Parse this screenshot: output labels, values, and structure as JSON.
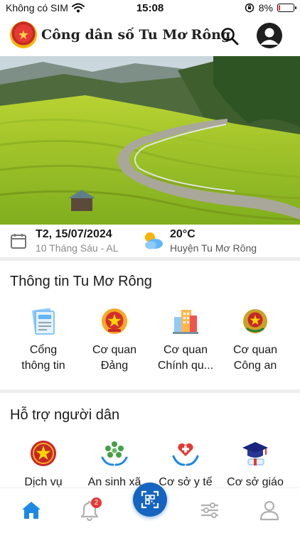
{
  "status_bar": {
    "carrier": "Không có SIM",
    "time": "15:08",
    "battery_percent": "8%",
    "battery_level": 0.08
  },
  "header": {
    "title": "Công dân số Tu Mơ Rông",
    "logo_icon": "national-emblem-icon",
    "search_icon": "search-icon",
    "account_icon": "account-icon"
  },
  "info": {
    "date": "T2, 15/07/2024",
    "lunar_date": "10 Tháng Sáu - AL",
    "temperature": "20°C",
    "location": "Huyện Tu Mơ Rông"
  },
  "section_info": {
    "title": "Thông tin Tu Mơ Rông",
    "items": [
      {
        "label": "Cổng\nthông tin",
        "icon": "newspaper-icon"
      },
      {
        "label": "Cơ quan\nĐảng",
        "icon": "party-emblem-icon"
      },
      {
        "label": "Cơ quan\nChính qu...",
        "icon": "government-building-icon"
      },
      {
        "label": "Cơ quan\nCông an",
        "icon": "police-emblem-icon"
      }
    ]
  },
  "section_support": {
    "title": "Hỗ trợ người dân",
    "items": [
      {
        "label": "Dịch vụ",
        "icon": "public-service-icon"
      },
      {
        "label": "An sinh xã",
        "icon": "social-welfare-icon"
      },
      {
        "label": "Cơ sở y tế",
        "icon": "healthcare-icon"
      },
      {
        "label": "Cơ sở giáo",
        "icon": "education-icon"
      }
    ]
  },
  "bottom_nav": {
    "notification_count": "2",
    "items": [
      "home-icon",
      "bell-icon",
      "qr-scan-icon",
      "sliders-icon",
      "profile-icon"
    ]
  },
  "colors": {
    "accent": "#1565c0",
    "home_active": "#1e88e5",
    "nav_inactive": "#b0b0b0",
    "badge": "#e53935"
  }
}
